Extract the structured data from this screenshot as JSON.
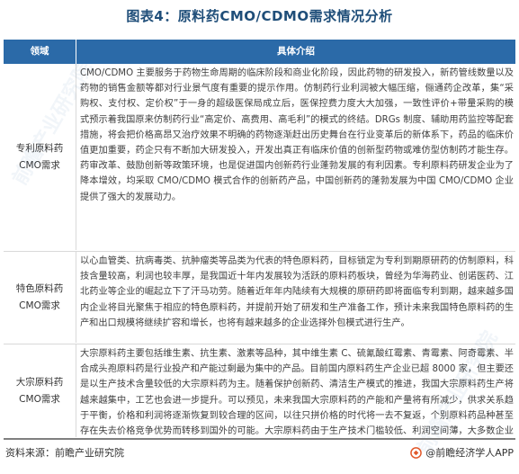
{
  "title": "图表4：原料药CMO/CDMO需求情况分析",
  "table": {
    "headers": [
      "领域",
      "具体介绍"
    ],
    "rows": [
      {
        "label": "专利原料药CMO需求",
        "text": "CMO/CDMO 主要服务于药物生命周期的临床阶段和商业化阶段，因此药物的研发投入，新药管线数量以及药物的销售金额等都对行业景气度有重要的提示作用。仿制药行业利润被大幅压缩，俪通药企改革，集“采购权、支付权、定价权”于一身的超级医保局成立后，医保控费力度大大加强，一致性评价+带量采购的模式预示着我国原来仿制药行业“高定价、高费用、高毛利”的模式的终结。DRGs 制度、辅助用药监控等配套措施，将会把价格高昂又治疗效果不明确的药物逐渐赶出历史舞台在行业变革后的新体系下，药品的临床价值更加重要，药企只有不断加大研发投入，开发出真正有临床价值的创新型药物或难仿型仿制药才能生存。药审改革、鼓励创新等政策环境，也是促进国内创新药行业蓬勃发展的有利因素。专利原料药研发企业为了降本增效，均采取 CMO/CDMO 模式合作的创新药产品，中国创新药的蓬勃发展为中国 CMO/CDMO 企业提供了强大的发展动力。"
      },
      {
        "label": "特色原料药CMO需求",
        "text": "以心血管类、抗病毒类、抗肿瘤类等品类为代表的特色原料药，目标锁定为专利到期原研药的仿制原料，科技含量较高，利润也较丰厚，是我国近十年内发展较为活跃的原料药板块，曾经为华海药业、创诺医药、江北药业等企业的崛起立下了汗马功劳。随着近年年内陆续有大规模的原研药即将面临专利到期，越来越多国内企业将目光聚焦于相应的特色原料药，并提前开始了研发和生产准备工作，预计未来我国特色原料药的生产和出口规模将继续扩容和增长，也将有越来越多的企业选择外包模式进行生产。"
      },
      {
        "label": "大宗原料药CMO需求",
        "text": "大宗原料药主要包括维生素、抗生素、激素等品种，其中维生素 C、硫氰酸红霉素、青霉素、阿奇霉素、半合成头孢原料药是行业投产和产能过剩最为集中的产品。目前国内原料药生产企业已超 8000 家，但主要还是以生产技术含量较低的大宗原料药为主。随着保护创新药、清洁生产模式的推进，我国大宗原料药生产将越来越集中，工艺也会进一步提升。可以预见，未来我国大宗原料药的产能和产量将有所减少，供求关系趋于平衡，价格和利润将逐渐恢复到较合理的区间，以往只拼价格的时代将一去不复返，个别原料药品种甚至存在失去价格竞争优势而转移到国外的可能。大宗原料药由于生产技术门槛较低、利润空间薄，大多数企业对大宗原料药均采取自产自销的模式，未来大宗原料药的 CMO 需要也将进一步转移至特色原料药的CMO。"
      }
    ]
  },
  "footer": {
    "source": "资料来源：前瞻产业研究院",
    "brand": "@前瞻经济学人APP"
  },
  "watermark": "前瞻产业研究院"
}
